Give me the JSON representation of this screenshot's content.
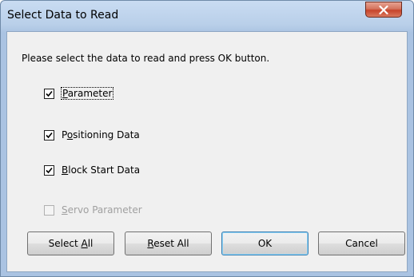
{
  "window": {
    "title": "Select Data to Read",
    "close_icon": "close-x-icon"
  },
  "dialog": {
    "instruction": "Please select the data to read and press OK button."
  },
  "checkboxes": [
    {
      "label": "Parameter",
      "accel": "P",
      "rest": "arameter",
      "checked": true,
      "enabled": true
    },
    {
      "label": "Positioning Data",
      "accel": "o",
      "pre": "P",
      "rest": "sitioning Data",
      "checked": true,
      "enabled": true
    },
    {
      "label": "Block Start Data",
      "accel": "B",
      "rest": "lock Start Data",
      "checked": true,
      "enabled": true
    },
    {
      "label": "Servo Parameter",
      "accel": "S",
      "rest": "ervo Parameter",
      "checked": false,
      "enabled": false
    }
  ],
  "buttons": {
    "select_all": {
      "pre": "Select ",
      "accel": "A",
      "rest": "ll"
    },
    "reset_all": {
      "pre": "",
      "accel": "R",
      "rest": "eset All"
    },
    "ok": "OK",
    "cancel": "Cancel"
  },
  "colors": {
    "title_gradient": "#c9dcf2",
    "close_button": "#c7432a",
    "client_bg": "#f0f0f0"
  }
}
